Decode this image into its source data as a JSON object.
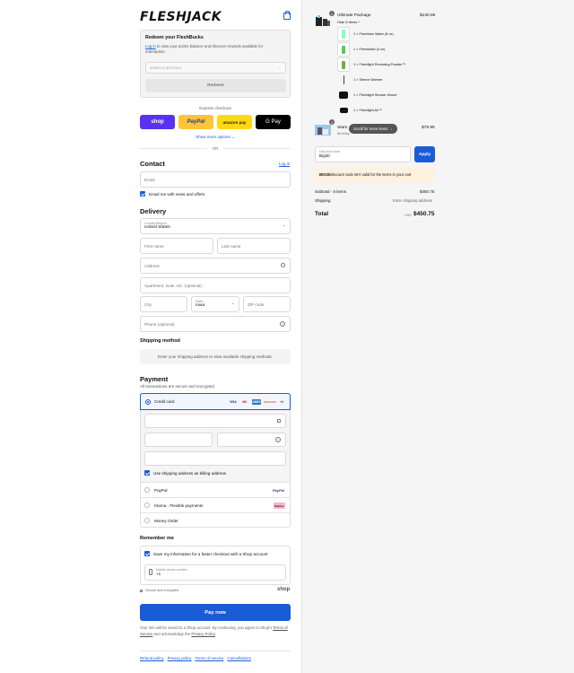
{
  "brand": {
    "logo": "FLESHJACK"
  },
  "icons": {
    "bag": "shopping-bag-icon",
    "search": "search-icon",
    "lock": "lock-icon",
    "help": "help-circle-icon",
    "chevron": "chevron-down-icon"
  },
  "colors": {
    "accent": "#1a5bd8",
    "shop": "#5a31f4",
    "paypal": "#ffc439",
    "amazon": "#ffd814",
    "gpay": "#000000",
    "warning_bg": "#fdf1e0"
  },
  "rewards": {
    "title": "Redeem your FleshBucks",
    "login_link": "Log in",
    "description": " to view your points balance and discover rewards available for redemption.",
    "select_placeholder": "Select a discount",
    "redeem_label": "Redeem"
  },
  "express": {
    "label": "Express checkout",
    "shop": "shop",
    "paypal": "PayPal",
    "amazon": "amazon pay",
    "gpay": "G Pay",
    "show_more": "Show more options",
    "or": "OR"
  },
  "contact": {
    "title": "Contact",
    "login": "Log in",
    "email_placeholder": "Email",
    "news_label": "Email me with news and offers"
  },
  "delivery": {
    "title": "Delivery",
    "country_label": "Country/Region",
    "country_value": "United States",
    "first_name": "First name",
    "last_name": "Last name",
    "address": "Address",
    "apartment": "Apartment, suite, etc. (optional)",
    "city": "City",
    "state_label": "State",
    "state_value": "Iowa",
    "zip": "ZIP code",
    "phone": "Phone (optional)"
  },
  "shipping_method": {
    "title": "Shipping method",
    "message": "Enter your shipping address to view available shipping methods."
  },
  "payment": {
    "title": "Payment",
    "subtitle": "All transactions are secure and encrypted.",
    "credit_card": "Credit card",
    "card_brands": [
      "VISA",
      "MC",
      "AMEX",
      "DISCOVER",
      "+4"
    ],
    "billing_label": "Use shipping address as billing address",
    "paypal": "PayPal",
    "paypal_logo": "PayPal",
    "klarna": "Klarna - Flexible payments",
    "klarna_logo": "Klarna.",
    "money_order": "Money Order"
  },
  "remember": {
    "title": "Remember me",
    "save_label": "Save my information for a faster checkout with a Shop account",
    "mobile_label": "Mobile phone number",
    "mobile_value": "+1",
    "secure": "Secure and encrypted",
    "shop": "shop"
  },
  "pay_now": "Pay now",
  "legal": {
    "text1": "Your info will be saved to a Shop account. By continuing, you agree to Shop’s ",
    "terms": "Terms of Service",
    "text2": " and acknowledge the ",
    "privacy": "Privacy Policy",
    "text3": "."
  },
  "footer": [
    "Refund policy",
    "Privacy policy",
    "Terms of service",
    "Cancellations"
  ],
  "summary": {
    "package": {
      "qty": "1",
      "title": "Ultimate Package",
      "price": "$130.95",
      "toggle": "Hide 6 items"
    },
    "items": [
      "1 × Fleshlube Water (8 oz)",
      "1 × Fleshwash (4 oz)",
      "1 × Fleshlight Renewing Powder™",
      "1 × Sleeve Warmer",
      "1 × Fleshlight Shower Mount",
      "1 × Fleshlight Air™"
    ],
    "second": {
      "qty": "1",
      "title": "Stam",
      "subtitle": "Birthday",
      "price": "$79.95"
    },
    "scroll_pill": "Scroll for more items",
    "discount_label": "Discount code",
    "discount_value": "Big30",
    "apply": "Apply",
    "warning_code": "BIG30",
    "warning_text": " discount code isn't valid for the items in your cart",
    "subtotal_label": "Subtotal · 5 items",
    "subtotal_value": "$450.75",
    "shipping_label": "Shipping",
    "shipping_value": "Enter shipping address",
    "total_label": "Total",
    "currency": "USD",
    "total_value": "$450.75"
  }
}
